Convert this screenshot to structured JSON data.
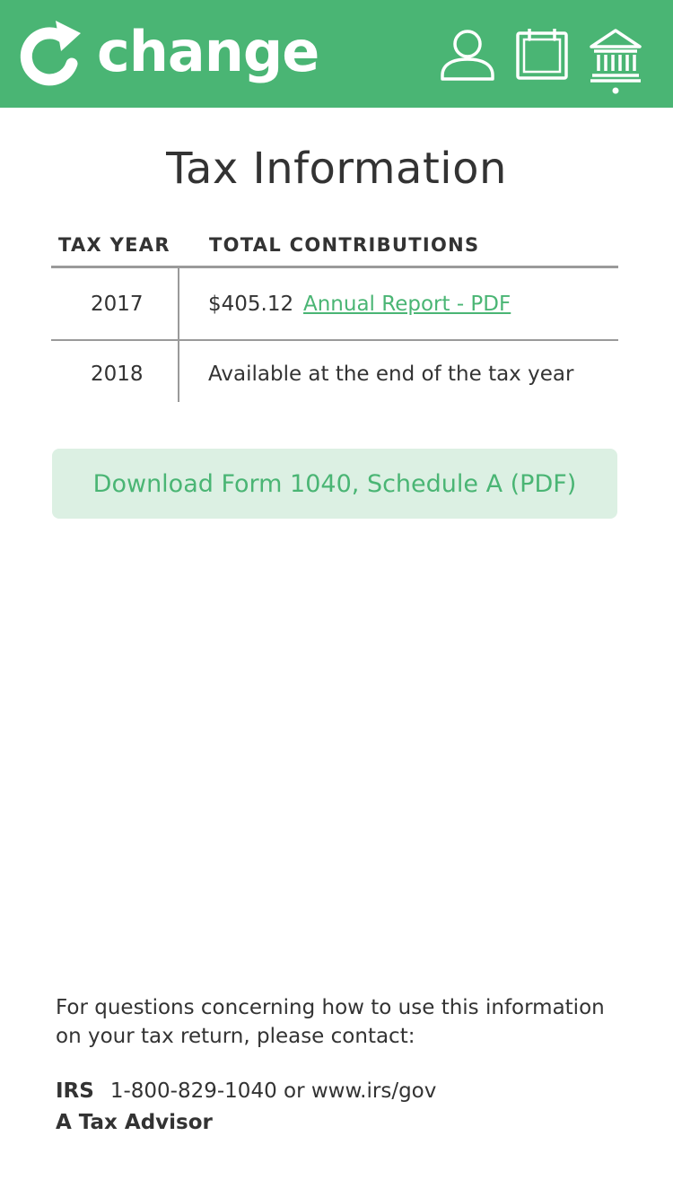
{
  "header": {
    "brand": "change",
    "icons": [
      "refresh-arrow-logo-icon",
      "user-icon",
      "notebook-icon",
      "bank-icon"
    ],
    "colors": {
      "brand_green": "#4ab574",
      "button_bg": "#dcf0e3",
      "text": "#333333"
    }
  },
  "page_title": "Tax Information",
  "table": {
    "headers": {
      "year": "TAX YEAR",
      "contributions": "TOTAL CONTRIBUTIONS"
    },
    "rows": [
      {
        "year": "2017",
        "amount": "$405.12",
        "link": "Annual Report - PDF"
      },
      {
        "year": "2018",
        "note": "Available at the end of the tax year"
      }
    ]
  },
  "download_button": "Download Form 1040, Schedule A (PDF)",
  "footer": {
    "note": "For questions concerning how to use this information on your tax return, please contact:",
    "irs_label": "IRS",
    "irs_contact": "1-800-829-1040 or www.irs/gov",
    "advisor": "A Tax Advisor"
  }
}
